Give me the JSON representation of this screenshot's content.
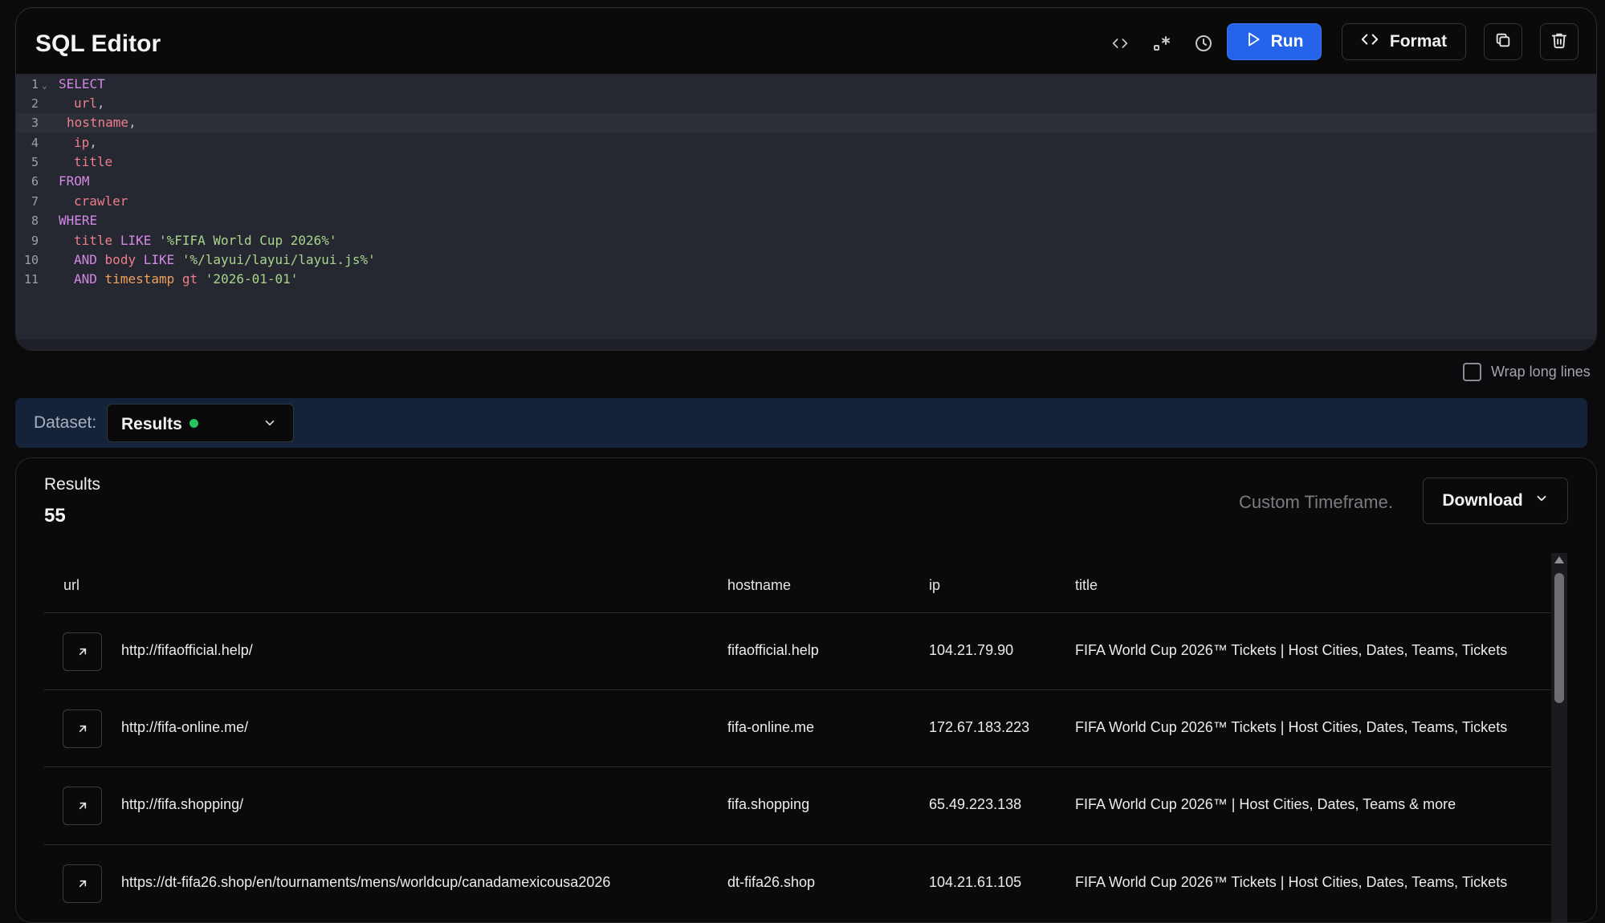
{
  "editor": {
    "title": "SQL Editor",
    "toolbar": {
      "code_icon": "code-brackets-icon",
      "regex_icon": "regex-icon",
      "history_icon": "clock-icon",
      "run_label": "Run",
      "format_label": "Format",
      "copy_icon": "copy-icon",
      "delete_icon": "trash-icon"
    },
    "lines": [
      {
        "n": "1",
        "text": "SELECT"
      },
      {
        "n": "2",
        "text": "url,"
      },
      {
        "n": "3",
        "text": "hostname,"
      },
      {
        "n": "4",
        "text": "ip,"
      },
      {
        "n": "5",
        "text": "title"
      },
      {
        "n": "6",
        "text": "FROM"
      },
      {
        "n": "7",
        "text": "crawler"
      },
      {
        "n": "8",
        "text": "WHERE"
      },
      {
        "n": "9",
        "text": "title LIKE '%FIFA World Cup 2026%'"
      },
      {
        "n": "10",
        "text": "AND body LIKE '%/layui/layui/layui.js%'"
      },
      {
        "n": "11",
        "text": "AND timestamp gt '2026-01-01'"
      }
    ],
    "tokens": {
      "l1": "SELECT",
      "l2_col": "url",
      "l2_p": ",",
      "l3_col": "hostname",
      "l3_p": ",",
      "l4_col": "ip",
      "l4_p": ",",
      "l5_col": "title",
      "l6": "FROM",
      "l7_col": "crawler",
      "l8": "WHERE",
      "l9_col": "title",
      "l9_kw": "LIKE",
      "l9_str": "'%FIFA World Cup 2026%'",
      "l10_kw1": "AND",
      "l10_col": "body",
      "l10_kw2": "LIKE",
      "l10_str": "'%/layui/layui/layui.js%'",
      "l11_kw": "AND",
      "l11_col": "timestamp",
      "l11_op": "gt",
      "l11_str": "'2026-01-01'"
    }
  },
  "wrap": {
    "label": "Wrap long lines",
    "checked": false
  },
  "dataset": {
    "label": "Dataset:",
    "value": "Results",
    "status_color": "#22c55e"
  },
  "results": {
    "label": "Results",
    "count": "55",
    "timeframe": "Custom Timeframe.",
    "download_label": "Download",
    "columns": [
      "url",
      "hostname",
      "ip",
      "title"
    ],
    "rows": [
      {
        "url": "http://fifaofficial.help/",
        "hostname": "fifaofficial.help",
        "ip": "104.21.79.90",
        "title": "FIFA World Cup 2026™ Tickets | Host Cities, Dates, Teams, Tickets"
      },
      {
        "url": "http://fifa-online.me/",
        "hostname": "fifa-online.me",
        "ip": "172.67.183.223",
        "title": "FIFA World Cup 2026™ Tickets | Host Cities, Dates, Teams, Tickets"
      },
      {
        "url": "http://fifa.shopping/",
        "hostname": "fifa.shopping",
        "ip": "65.49.223.138",
        "title": "FIFA World Cup 2026™ | Host Cities, Dates, Teams & more"
      },
      {
        "url": "https://dt-fifa26.shop/en/tournaments/mens/worldcup/canadamexicousa2026",
        "hostname": "dt-fifa26.shop",
        "ip": "104.21.61.105",
        "title": "FIFA World Cup 2026™ Tickets | Host Cities, Dates, Teams, Tickets"
      }
    ]
  },
  "colors": {
    "accent": "#2563eb",
    "keyword": "#d488e6",
    "column": "#ef7d8a",
    "string": "#a8d58c"
  }
}
